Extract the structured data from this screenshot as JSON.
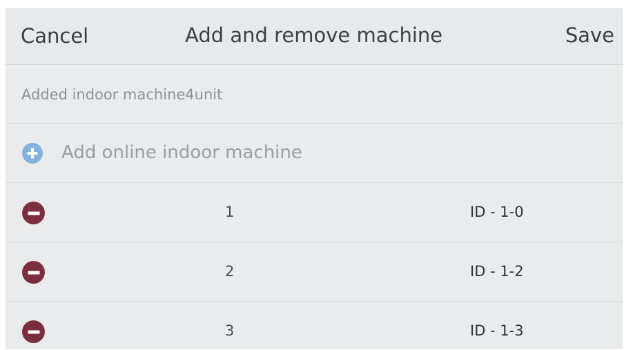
{
  "header": {
    "cancel_label": "Cancel",
    "title": "Add and remove machine",
    "save_label": "Save"
  },
  "section": {
    "added_label": "Added indoor machine4unit"
  },
  "add_online": {
    "label": "Add online indoor machine",
    "icon": "plus-circle-icon",
    "icon_color": "#86b3dd"
  },
  "machines": [
    {
      "number": "1",
      "id": "ID - 1-0"
    },
    {
      "number": "2",
      "id": "ID - 1-2"
    },
    {
      "number": "3",
      "id": "ID - 1-3"
    }
  ],
  "remove_icon": {
    "name": "minus-circle-icon",
    "color": "#7b2e3e"
  }
}
